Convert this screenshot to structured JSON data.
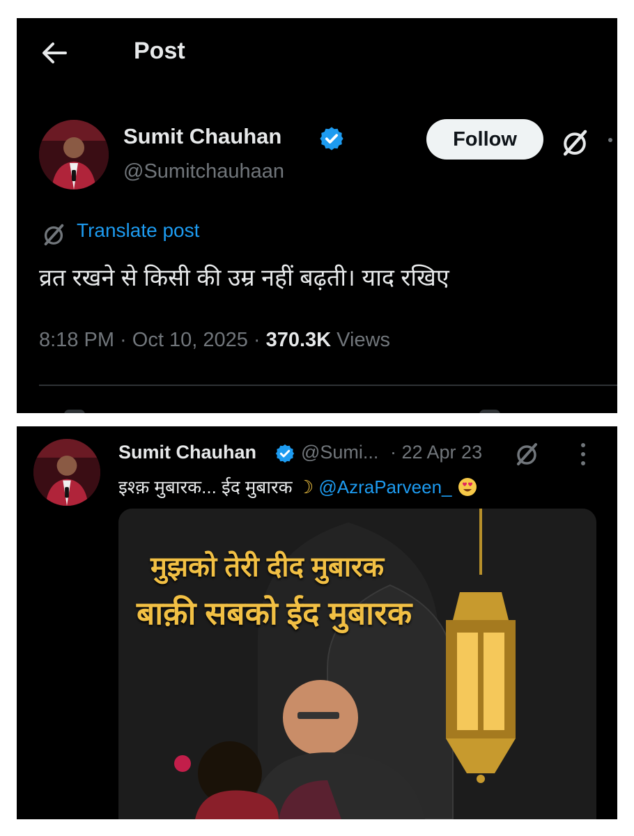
{
  "post_view": {
    "header_title": "Post",
    "author_name": "Sumit Chauhan",
    "author_handle": "@Sumitchauhaan",
    "follow_label": "Follow",
    "translate_label": "Translate post",
    "text": "व्रत रखने से किसी की उम्र नहीं बढ़ती। याद रखिए",
    "time": "8:18 PM · Oct 10, 2025 · ",
    "views_count": "370.3K",
    "views_label": " Views"
  },
  "old_tweet": {
    "author_name": "Sumit Chauhan",
    "author_handle": "@Sumi...",
    "time": "· 22 Apr 23",
    "text": "इश्क़ मुबारक... ईद मुबारक ",
    "moon_emoji": "☽",
    "mention": "@AzraParveen_",
    "image_text_line1": "मुझको तेरी दीद मुबारक",
    "image_text_line2": "बाक़ी सबको ईद मुबारक"
  },
  "colors": {
    "background": "#000000",
    "accent": "#1d9bf0",
    "secondary_text": "#71767b",
    "banner_gold": "#f2c044"
  },
  "icons": [
    "back-arrow-icon",
    "verified-badge-icon",
    "grok-icon",
    "more-icon",
    "kebab-icon",
    "heart-eyes-emoji-icon",
    "lantern-icon"
  ]
}
